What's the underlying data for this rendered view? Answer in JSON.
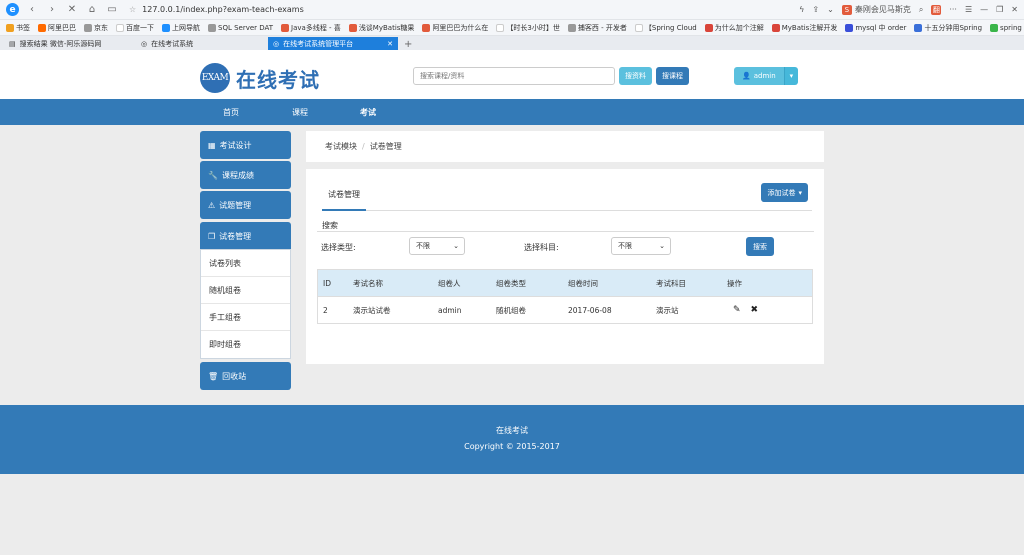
{
  "browser": {
    "url": "127.0.0.1/index.php?exam-teach-exams",
    "search_hint": "秦刚会见马斯克",
    "bookmarks": [
      "书签",
      "阿里巴巴",
      "京东",
      "百度一下",
      "上网导航",
      "SQL Server DAT",
      "Java多线程 - 喜",
      "浅谈MyBatis糖果",
      "阿里巴巴为什么在",
      "【时长3小时】世",
      "捕客西 - 开发者",
      "【Spring Cloud",
      "为什么加个注解",
      "MyBatis注解开发",
      "mysql 中 order",
      "十五分钟用Spring",
      "spring"
    ],
    "tabs": [
      {
        "label": "搜索结果 微信-阿乐源码网",
        "active": false
      },
      {
        "label": "在线考试系统",
        "active": false
      },
      {
        "label": "在线考试系统管理平台",
        "active": true
      }
    ]
  },
  "site": {
    "logo_text": "EXAM",
    "name": "在线考试",
    "search_placeholder": "搜索课程/资料",
    "search_material_btn": "搜资料",
    "search_course_btn": "搜课程",
    "user": "admin"
  },
  "nav": [
    "首页",
    "课程",
    "考试"
  ],
  "sidebar": {
    "items": [
      {
        "label": "考试设计",
        "icon": "grid-icon"
      },
      {
        "label": "课程成绩",
        "icon": "wrench-icon"
      },
      {
        "label": "试题管理",
        "icon": "warning-icon"
      },
      {
        "label": "试卷管理",
        "icon": "copy-icon"
      }
    ],
    "sub_items": [
      "试卷列表",
      "随机组卷",
      "手工组卷",
      "即时组卷"
    ],
    "trash": "回收站"
  },
  "breadcrumb": [
    "考试模块",
    "试卷管理"
  ],
  "content": {
    "title": "试卷管理",
    "add_btn": "添加试卷",
    "search_label": "搜索",
    "filter_type_label": "选择类型:",
    "filter_type_value": "不限",
    "filter_subject_label": "选择科目:",
    "filter_subject_value": "不限",
    "search_btn": "搜索"
  },
  "table": {
    "headers": [
      "ID",
      "考试名称",
      "组卷人",
      "组卷类型",
      "组卷时间",
      "考试科目",
      "操作"
    ],
    "rows": [
      [
        "2",
        "演示站试卷",
        "admin",
        "随机组卷",
        "2017-06-08",
        "演示站"
      ]
    ]
  },
  "footer": {
    "line1": "在线考试",
    "line2": "Copyright © 2015-2017"
  }
}
